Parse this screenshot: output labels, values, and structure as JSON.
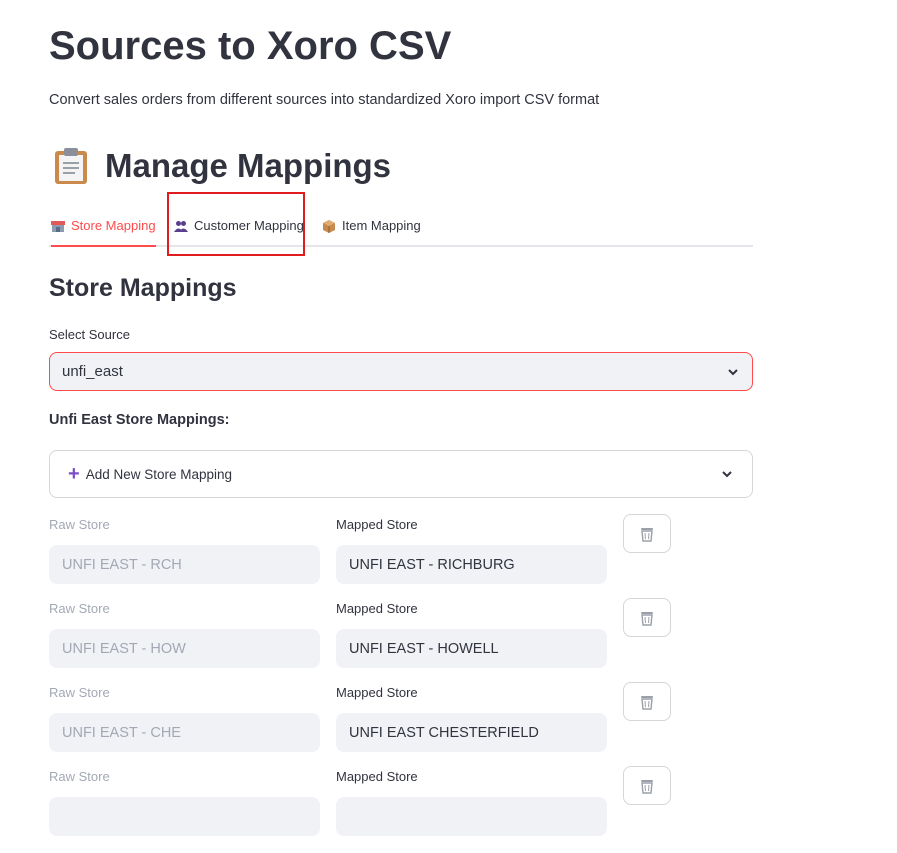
{
  "header": {
    "title": "Sources to Xoro CSV",
    "subtitle": "Convert sales orders from different sources into standardized Xoro import CSV format"
  },
  "section": {
    "icon": "clipboard-icon",
    "title": "Manage Mappings"
  },
  "tabs": [
    {
      "label": "Store Mapping",
      "icon": "store-icon",
      "active": true
    },
    {
      "label": "Customer Mapping",
      "icon": "people-icon",
      "active": false
    },
    {
      "label": "Item Mapping",
      "icon": "package-icon",
      "active": false
    }
  ],
  "store_mappings": {
    "title": "Store Mappings",
    "select_label": "Select Source",
    "selected_source": "unfi_east",
    "subheading": "Unfi East Store Mappings:",
    "add_new_label": "Add New Store Mapping",
    "raw_label": "Raw Store",
    "mapped_label": "Mapped Store",
    "rows": [
      {
        "raw": "UNFI EAST - RCH",
        "mapped": "UNFI EAST - RICHBURG"
      },
      {
        "raw": "UNFI EAST - HOW",
        "mapped": "UNFI EAST - HOWELL"
      },
      {
        "raw": "UNFI EAST - CHE",
        "mapped": "UNFI EAST CHESTERFIELD"
      },
      {
        "raw": "",
        "mapped": ""
      }
    ]
  },
  "colors": {
    "accent": "#ff4b4b",
    "highlight": "#e01d1d",
    "input_bg": "#f0f2f6",
    "text": "#31333f",
    "disabled_text": "#a3a8b4",
    "plus": "#7a4fc6"
  }
}
